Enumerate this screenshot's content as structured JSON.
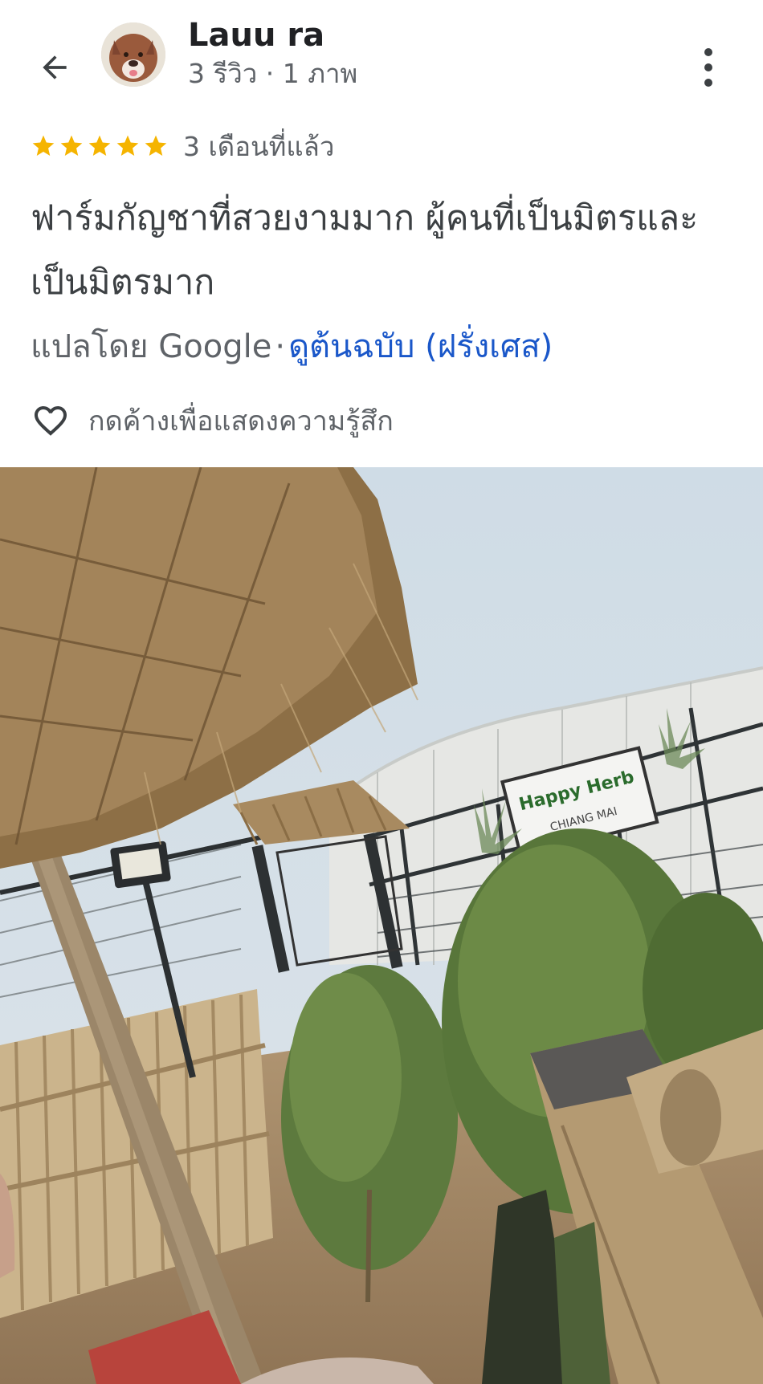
{
  "header": {
    "back_icon": "arrow-back-icon",
    "avatar_icon": "dog-avatar",
    "reviewer_name": "Lauu ra",
    "reviewer_meta": "3 รีวิว · 1 ภาพ",
    "more_icon": "more-vertical-icon"
  },
  "review": {
    "rating": 5,
    "rating_max": 5,
    "star_color": "#f5b400",
    "time_ago": "3 เดือนที่แล้ว",
    "text": "ฟาร์มกัญชาที่สวยงามมาก ผู้คนที่เป็นมิตรและเป็นมิตรมาก",
    "translated_by": "แปลโดย Google",
    "separator": "·",
    "view_original": "ดูต้นฉบับ (ฝรั่งเศส)",
    "link_color": "#1a57c9",
    "react_icon": "heart-outline-icon",
    "react_label": "กดค้างเพื่อแสดงความรู้สึก"
  },
  "photo": {
    "sign_title": "Happy Herb",
    "sign_subtitle": "CHIANG MAI"
  }
}
